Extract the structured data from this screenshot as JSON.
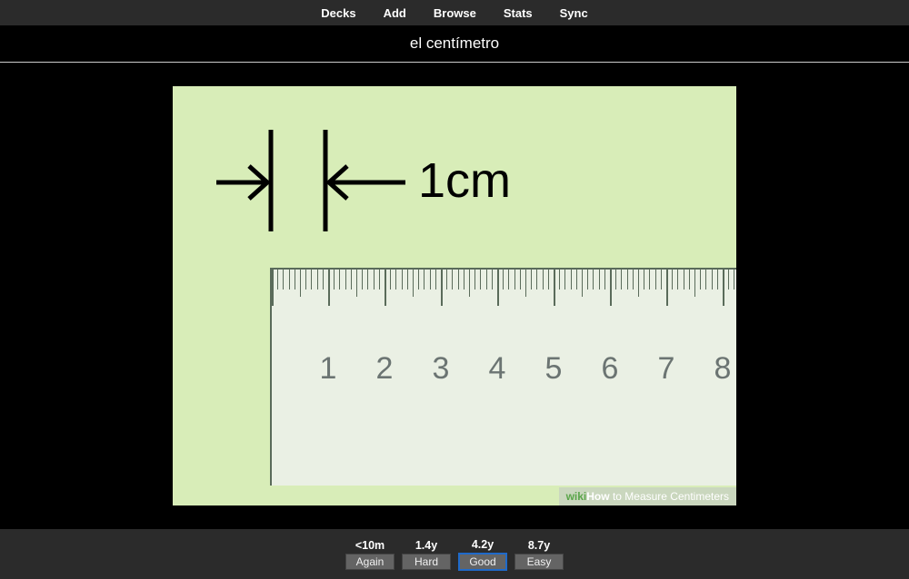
{
  "nav": {
    "items": [
      "Decks",
      "Add",
      "Browse",
      "Stats",
      "Sync"
    ]
  },
  "card": {
    "front": "el centímetro",
    "diagram": {
      "label_text": "1cm",
      "ruler_numbers": [
        "1",
        "2",
        "3",
        "4",
        "5",
        "6",
        "7",
        "8"
      ],
      "watermark": {
        "wiki": "wiki",
        "how": "How",
        "rest": " to Measure Centimeters"
      }
    }
  },
  "review": {
    "buttons": [
      {
        "interval": "<10m",
        "label": "Again",
        "selected": false
      },
      {
        "interval": "1.4y",
        "label": "Hard",
        "selected": false
      },
      {
        "interval": "4.2y",
        "label": "Good",
        "selected": true
      },
      {
        "interval": "8.7y",
        "label": "Easy",
        "selected": false
      }
    ]
  }
}
